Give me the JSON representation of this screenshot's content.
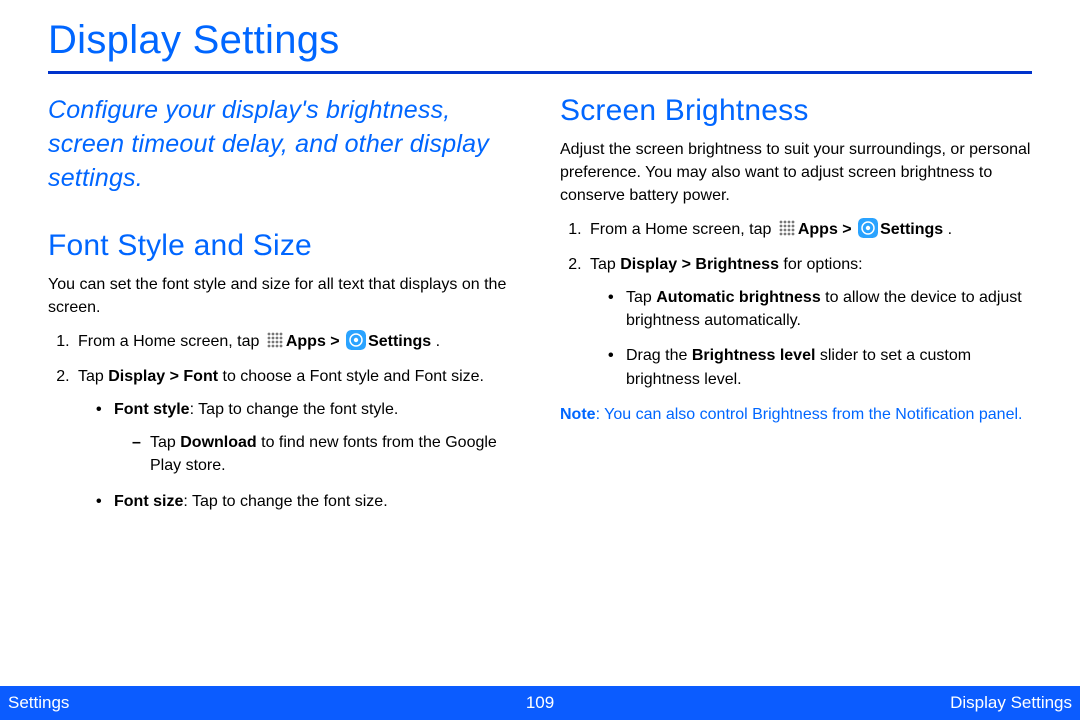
{
  "title": "Display Settings",
  "intro": "Configure your display's brightness, screen timeout delay, and other display settings.",
  "font": {
    "heading": "Font Style and Size",
    "lead": "You can set the font style and size for all text that displays on the screen.",
    "step1_pre": "From a Home screen, tap ",
    "apps_label": "Apps > ",
    "settings_label": "Settings",
    "step1_post": " .",
    "step2_a": "Tap ",
    "step2_b": "Display > Font",
    "step2_c": " to choose a Font style and Font size.",
    "b1_label": "Font style",
    "b1_rest": ": Tap to change the font style.",
    "b1_sub_a": "Tap ",
    "b1_sub_b": "Download",
    "b1_sub_c": " to find new fonts from the Google Play store.",
    "b2_label": "Font size",
    "b2_rest": ": Tap to change the font size."
  },
  "bright": {
    "heading": "Screen Brightness",
    "lead": "Adjust the screen brightness to suit your surroundings, or personal preference. You may also want to adjust screen brightness to conserve battery power.",
    "step1_pre": "From a Home screen, tap ",
    "apps_label": "Apps > ",
    "settings_label": "Settings",
    "step1_post": " .",
    "step2_a": "Tap ",
    "step2_b": "Display > Brightness",
    "step2_c": " for options:",
    "b1_a": "Tap ",
    "b1_b": "Automatic brightness",
    "b1_c": " to allow the device to adjust brightness automatically.",
    "b2_a": "Drag the ",
    "b2_b": "Brightness level",
    "b2_c": " slider to set a custom brightness level.",
    "note_label": "Note",
    "note_rest": ": You can also control Brightness from the Notification panel."
  },
  "footer": {
    "left": "Settings",
    "center": "109",
    "right": "Display Settings"
  }
}
